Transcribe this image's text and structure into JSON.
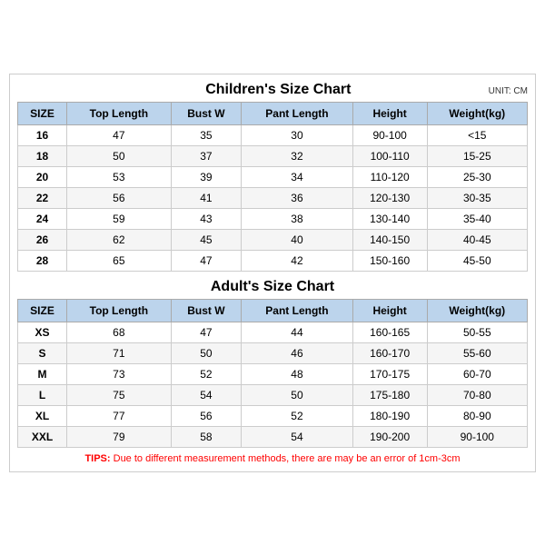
{
  "children_chart": {
    "title": "Children's Size Chart",
    "unit": "UNIT: CM",
    "headers": [
      "SIZE",
      "Top Length",
      "Bust W",
      "Pant Length",
      "Height",
      "Weight(kg)"
    ],
    "rows": [
      [
        "16",
        "47",
        "35",
        "30",
        "90-100",
        "<15"
      ],
      [
        "18",
        "50",
        "37",
        "32",
        "100-110",
        "15-25"
      ],
      [
        "20",
        "53",
        "39",
        "34",
        "110-120",
        "25-30"
      ],
      [
        "22",
        "56",
        "41",
        "36",
        "120-130",
        "30-35"
      ],
      [
        "24",
        "59",
        "43",
        "38",
        "130-140",
        "35-40"
      ],
      [
        "26",
        "62",
        "45",
        "40",
        "140-150",
        "40-45"
      ],
      [
        "28",
        "65",
        "47",
        "42",
        "150-160",
        "45-50"
      ]
    ]
  },
  "adult_chart": {
    "title": "Adult's Size Chart",
    "headers": [
      "SIZE",
      "Top Length",
      "Bust W",
      "Pant Length",
      "Height",
      "Weight(kg)"
    ],
    "rows": [
      [
        "XS",
        "68",
        "47",
        "44",
        "160-165",
        "50-55"
      ],
      [
        "S",
        "71",
        "50",
        "46",
        "160-170",
        "55-60"
      ],
      [
        "M",
        "73",
        "52",
        "48",
        "170-175",
        "60-70"
      ],
      [
        "L",
        "75",
        "54",
        "50",
        "175-180",
        "70-80"
      ],
      [
        "XL",
        "77",
        "56",
        "52",
        "180-190",
        "80-90"
      ],
      [
        "XXL",
        "79",
        "58",
        "54",
        "190-200",
        "90-100"
      ]
    ]
  },
  "tips": {
    "label": "TIPS:",
    "text": " Due to different measurement methods, there are may be an error of 1cm-3cm"
  }
}
